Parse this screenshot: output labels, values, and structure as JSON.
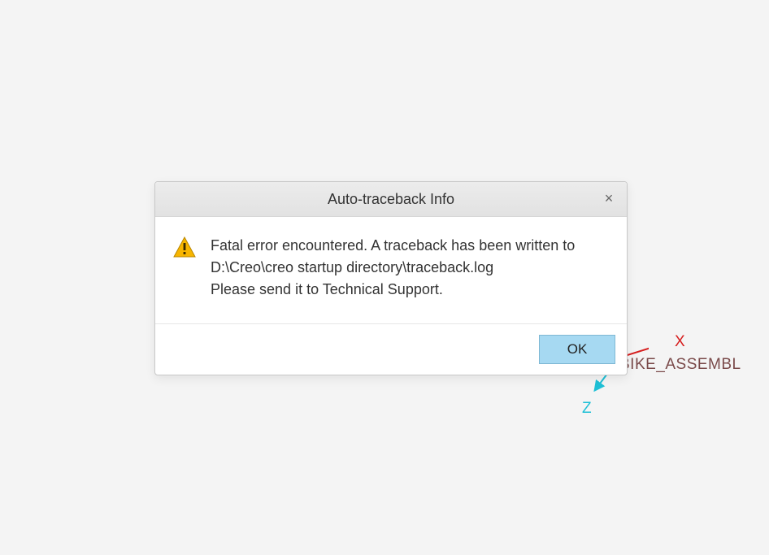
{
  "csys": {
    "x_label": "X",
    "z_label": "Z",
    "object_label": "BIKE_ASSEMBL"
  },
  "dialog": {
    "title": "Auto-traceback Info",
    "close_glyph": "×",
    "message_line1": "Fatal error encountered. A traceback has been written to",
    "message_line2": "D:\\Creo\\creo startup directory\\traceback.log",
    "message_line3": "Please send it to Technical Support.",
    "ok_label": "OK"
  }
}
